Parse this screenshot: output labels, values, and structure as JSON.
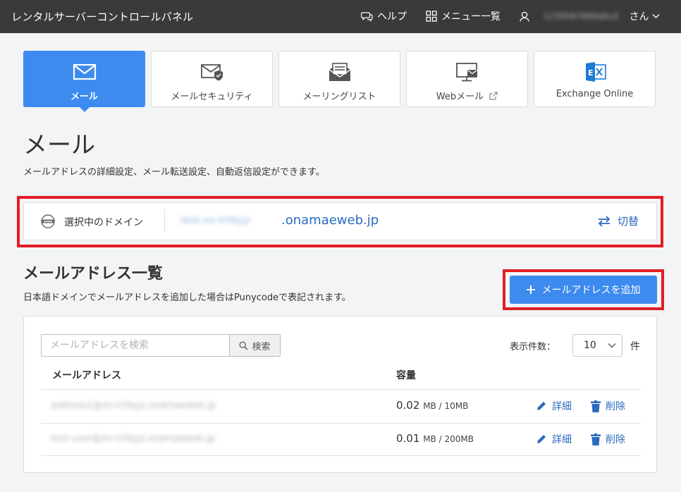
{
  "header": {
    "title": "レンタルサーバーコントロールパネル",
    "help": "ヘルプ",
    "menu": "メニュー一覧",
    "user_name": "1234567890abcd",
    "user_suffix": "さん"
  },
  "tabs": [
    {
      "label": "メール",
      "icon": "mail-icon",
      "active": true
    },
    {
      "label": "メールセキュリティ",
      "icon": "mail-shield-icon",
      "active": false
    },
    {
      "label": "メーリングリスト",
      "icon": "mailing-list-icon",
      "active": false
    },
    {
      "label": "Webメール",
      "icon": "webmail-icon",
      "active": false
    },
    {
      "label": "Exchange Online",
      "icon": "exchange-icon",
      "active": false
    }
  ],
  "page": {
    "title": "メール",
    "description": "メールアドレスの詳細設定、メール転送設定、自動返信設定ができます。"
  },
  "domain": {
    "label": "選択中のドメイン",
    "prefix_blurred": "test-xn-lcfdyjz",
    "suffix": ".onamaeweb.jp",
    "switch_label": "切替"
  },
  "address_list": {
    "title": "メールアドレス一覧",
    "description": "日本語ドメインでメールアドレスを追加した場合はPunycodeで表記されます。",
    "add_button": "メールアドレスを追加",
    "search_placeholder": "メールアドレスを検索",
    "search_button": "検索",
    "per_page_label": "表示件数：",
    "per_page_value": "10",
    "per_page_unit": "件",
    "col_address": "メールアドレス",
    "col_capacity": "容量",
    "edit_label": "詳細",
    "delete_label": "削除",
    "rows": [
      {
        "address": "address1@xn-lcfdyjz.onamaeweb.jp",
        "used": "0.02",
        "unit": "MB / 10MB"
      },
      {
        "address": "test-user@xn-lcfdyjz.onamaeweb.jp",
        "used": "0.01",
        "unit": "MB / 200MB"
      }
    ]
  },
  "colors": {
    "header_bg": "#3a3a3c",
    "accent": "#3d8bef",
    "link": "#2a6bbf",
    "highlight": "#e21d24"
  }
}
